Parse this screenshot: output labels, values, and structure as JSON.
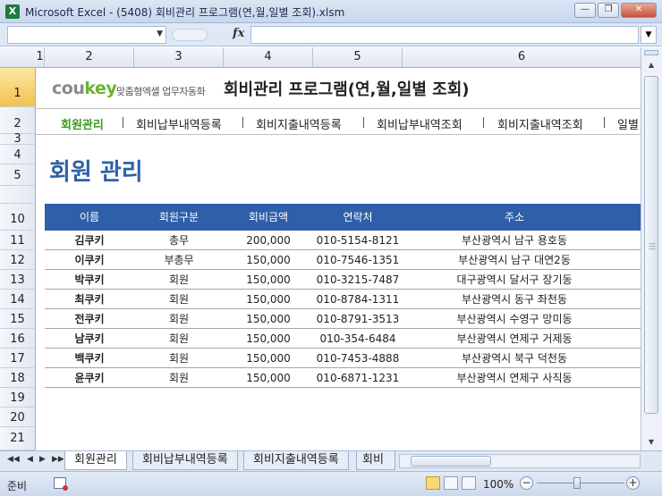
{
  "window": {
    "title": "Microsoft Excel - (5408) 회비관리 프로그램(연,월,일별 조회).xlsm",
    "app_icon": "X"
  },
  "formula_bar": {
    "fx_label": "fx",
    "cell_value": ""
  },
  "columns": [
    "1",
    "2",
    "3",
    "4",
    "5",
    "6"
  ],
  "rows": [
    "1",
    "2",
    "3",
    "4",
    "5",
    "10",
    "11",
    "12",
    "13",
    "14",
    "15",
    "16",
    "17",
    "18",
    "19",
    "20",
    "21"
  ],
  "header": {
    "logo_a": "cou",
    "logo_b": "key",
    "tagline": "맞춤형엑셀 업무자동화",
    "title": "회비관리 프로그램(연,월,일별 조회)"
  },
  "menu": [
    "회원관리",
    "회비납부내역등록",
    "회비지출내역등록",
    "회비납부내역조회",
    "회비지출내역조회",
    "일별"
  ],
  "section_title": "회원 관리",
  "table": {
    "headers": [
      "이름",
      "회원구분",
      "회비금액",
      "연락처",
      "주소"
    ],
    "rows": [
      [
        "김쿠키",
        "총무",
        "200,000",
        "010-5154-8121",
        "부산광역시 남구 용호동"
      ],
      [
        "이쿠키",
        "부총무",
        "150,000",
        "010-7546-1351",
        "부산광역시 남구 대연2동"
      ],
      [
        "박쿠키",
        "회원",
        "150,000",
        "010-3215-7487",
        "대구광역시 달서구 장기동"
      ],
      [
        "최쿠키",
        "회원",
        "150,000",
        "010-8784-1311",
        "부산광역시 동구 좌천동"
      ],
      [
        "전쿠키",
        "회원",
        "150,000",
        "010-8791-3513",
        "부산광역시 수영구 망미동"
      ],
      [
        "남쿠키",
        "회원",
        "150,000",
        "010-354-6484",
        "부산광역시 연제구 거제동"
      ],
      [
        "백쿠키",
        "회원",
        "150,000",
        "010-7453-4888",
        "부산광역시 북구 덕천동"
      ],
      [
        "윤쿠키",
        "회원",
        "150,000",
        "010-6871-1231",
        "부산광역시 연제구 사직동"
      ]
    ]
  },
  "sheet_tabs": [
    "회원관리",
    "회비납부내역등록",
    "회비지출내역등록",
    "회비"
  ],
  "status": {
    "ready": "준비",
    "zoom": "100%"
  },
  "colors": {
    "accent_blue": "#2e5fa8",
    "menu_active_green": "#3a9a1e",
    "logo_green": "#68b62b"
  }
}
